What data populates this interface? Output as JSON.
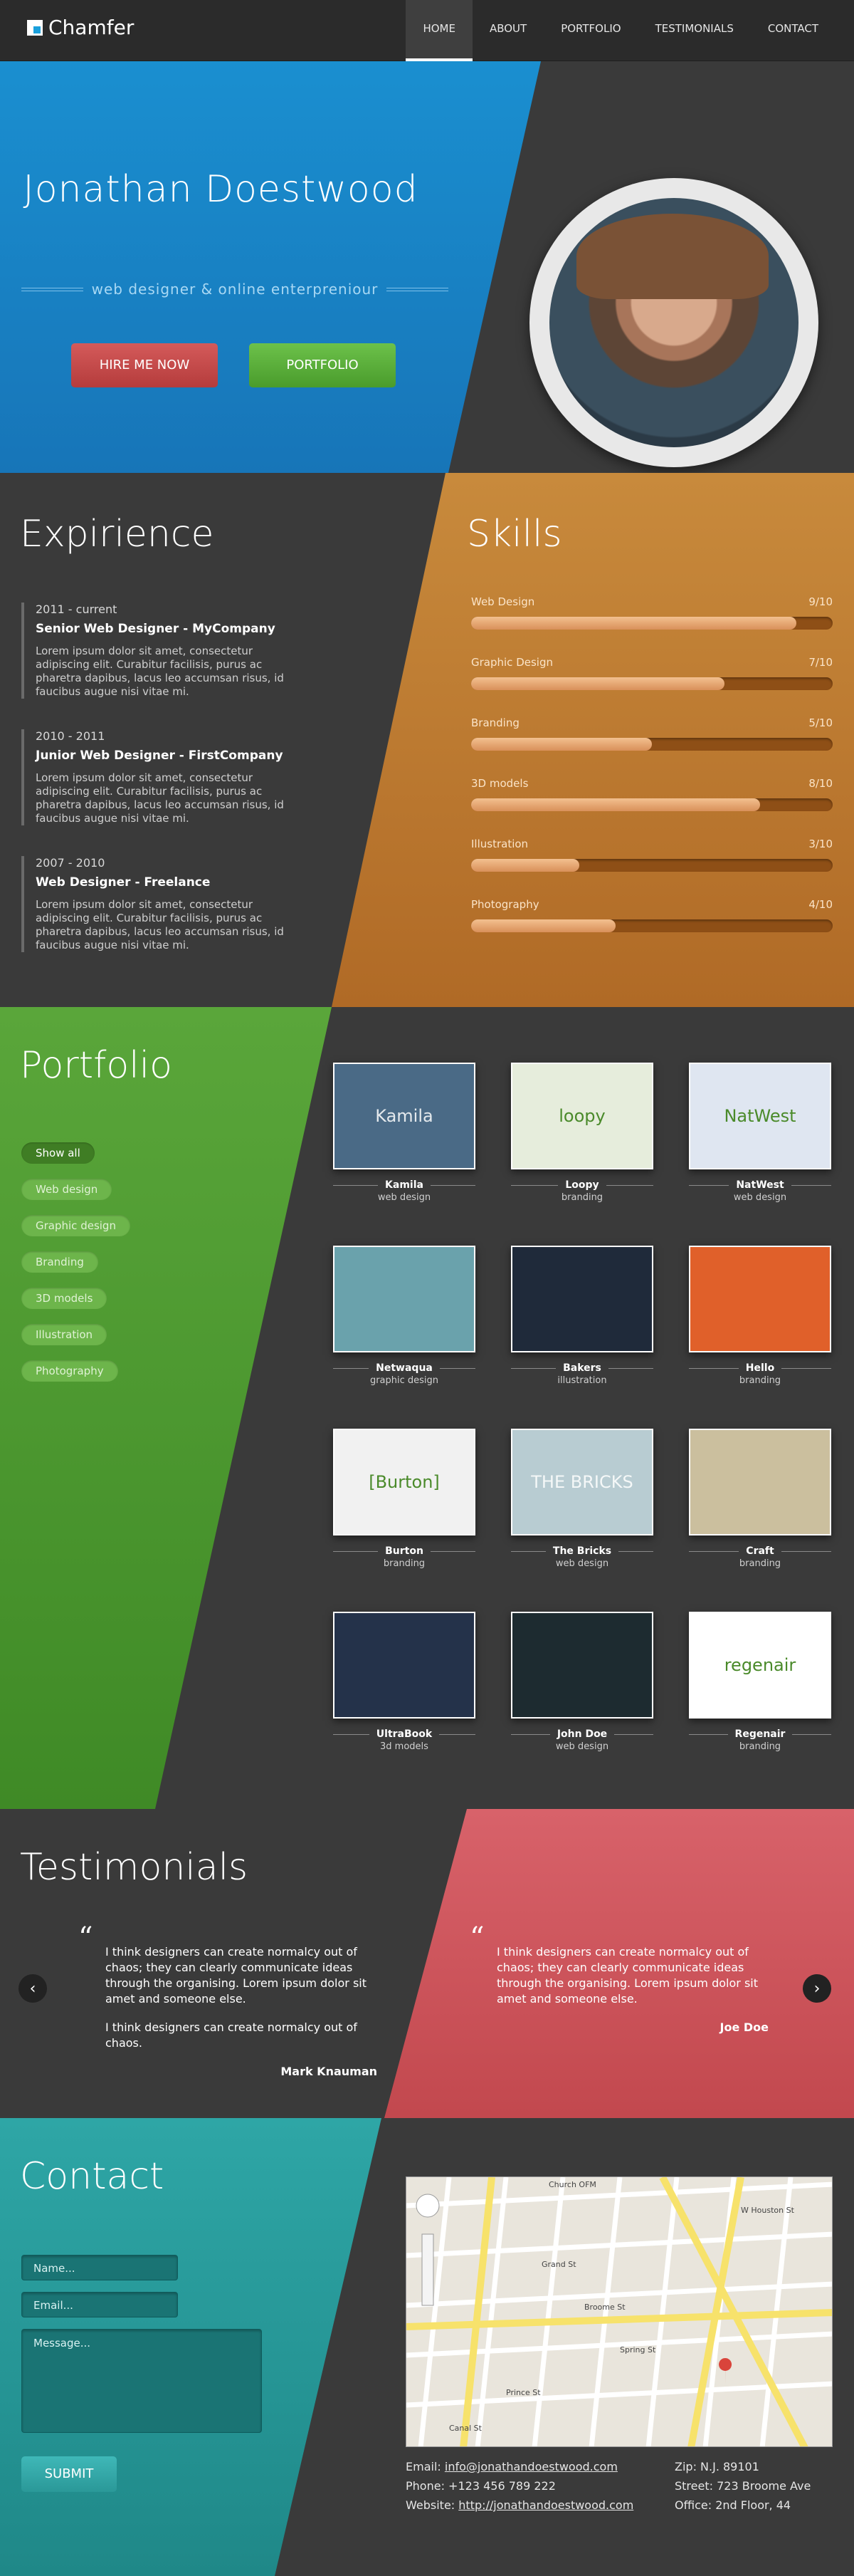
{
  "nav": {
    "logo": "Chamfer",
    "items": [
      "HOME",
      "ABOUT",
      "PORTFOLIO",
      "TESTIMONIALS",
      "CONTACT"
    ]
  },
  "hero": {
    "name": "Jonathan Doestwood",
    "tagline": "web designer & online enterpreniour",
    "hire_label": "HIRE ME NOW",
    "portfolio_label": "PORTFOLIO"
  },
  "experience": {
    "title": "Expirience",
    "items": [
      {
        "period": "2011 - current",
        "role": "Senior Web Designer - MyCompany",
        "desc": "Lorem ipsum dolor sit amet, consectetur adipiscing elit. Curabitur facilisis, purus ac pharetra dapibus, lacus leo accumsan risus, id faucibus augue nisi vitae mi."
      },
      {
        "period": "2010 - 2011",
        "role": "Junior Web Designer - FirstCompany",
        "desc": "Lorem ipsum dolor sit amet, consectetur adipiscing elit. Curabitur facilisis, purus ac pharetra dapibus, lacus leo accumsan risus, id faucibus augue nisi vitae mi."
      },
      {
        "period": "2007 - 2010",
        "role": "Web Designer - Freelance",
        "desc": "Lorem ipsum dolor sit amet, consectetur adipiscing elit. Curabitur facilisis, purus ac pharetra dapibus, lacus leo accumsan risus, id faucibus augue nisi vitae mi."
      }
    ]
  },
  "skills": {
    "title": "Skills",
    "items": [
      {
        "name": "Web Design",
        "score": "9/10",
        "value": 0.9
      },
      {
        "name": "Graphic Design",
        "score": "7/10",
        "value": 0.7
      },
      {
        "name": "Branding",
        "score": "5/10",
        "value": 0.5
      },
      {
        "name": "3D models",
        "score": "8/10",
        "value": 0.8
      },
      {
        "name": "Illustration",
        "score": "3/10",
        "value": 0.3
      },
      {
        "name": "Photography",
        "score": "4/10",
        "value": 0.4
      }
    ]
  },
  "portfolio": {
    "title": "Portfolio",
    "filters": [
      "Show all",
      "Web design",
      "Graphic design",
      "Branding",
      "3D models",
      "Illustration",
      "Photography"
    ],
    "items": [
      {
        "title": "Kamila",
        "category": "web design",
        "thumb_text": "Kamila",
        "color": "#4a6a86"
      },
      {
        "title": "Loopy",
        "category": "branding",
        "thumb_text": "loopy",
        "color": "#e6eddc"
      },
      {
        "title": "NatWest",
        "category": "web design",
        "thumb_text": "NatWest",
        "color": "#dfe6f1"
      },
      {
        "title": "Netwaqua",
        "category": "graphic design",
        "thumb_text": "",
        "color": "#6aa2ac"
      },
      {
        "title": "Bakers",
        "category": "illustration",
        "thumb_text": "",
        "color": "#1f2a3a"
      },
      {
        "title": "Hello",
        "category": "branding",
        "thumb_text": "",
        "color": "#e0602a"
      },
      {
        "title": "Burton",
        "category": "branding",
        "thumb_text": "[Burton]",
        "color": "#f1f1f1"
      },
      {
        "title": "The Bricks",
        "category": "web design",
        "thumb_text": "THE BRICKS",
        "color": "#b8ccd2"
      },
      {
        "title": "Craft",
        "category": "branding",
        "thumb_text": "",
        "color": "#cbbf9e"
      },
      {
        "title": "UltraBook",
        "category": "3d models",
        "thumb_text": "",
        "color": "#24324a"
      },
      {
        "title": "John Doe",
        "category": "web design",
        "thumb_text": "",
        "color": "#1d2b30"
      },
      {
        "title": "Regenair",
        "category": "branding",
        "thumb_text": "regenair",
        "color": "#ffffff"
      }
    ]
  },
  "testimonials": {
    "title": "Testimonials",
    "items": [
      {
        "paragraphs": [
          "I think designers can create normalcy out of chaos; they can clearly communicate ideas through the organising. Lorem ipsum dolor sit amet and someone else.",
          "I think designers can create normalcy out of chaos."
        ],
        "author": "Mark Knauman"
      },
      {
        "paragraphs": [
          "I think designers can create normalcy out of chaos; they can clearly communicate ideas through the organising. Lorem ipsum dolor sit amet and someone else."
        ],
        "author": "Joe Doe"
      }
    ],
    "prev": "‹",
    "next": "›",
    "quote_mark": "“"
  },
  "contact": {
    "title": "Contact",
    "name_placeholder": "Name...",
    "email_placeholder": "Email...",
    "message_placeholder": "Message...",
    "submit_label": "SUBMIT",
    "email_label": "Email:",
    "email_value": "info@jonathandoestwood.com",
    "phone_label": "Phone:",
    "phone_value": "+123 456 789 222",
    "website_label": "Website:",
    "website_value": "http://jonathandoestwood.com",
    "zip_label": "Zip:",
    "zip_value": "N.J. 89101",
    "street_label": "Street:",
    "street_value": "723 Broome Ave",
    "office_label": "Office:",
    "office_value": "2nd Floor, 44",
    "map_labels": [
      "Church OFM",
      "Grand St",
      "Broome St",
      "Spring St",
      "W Houston St",
      "Prince St",
      "Canal St"
    ]
  }
}
